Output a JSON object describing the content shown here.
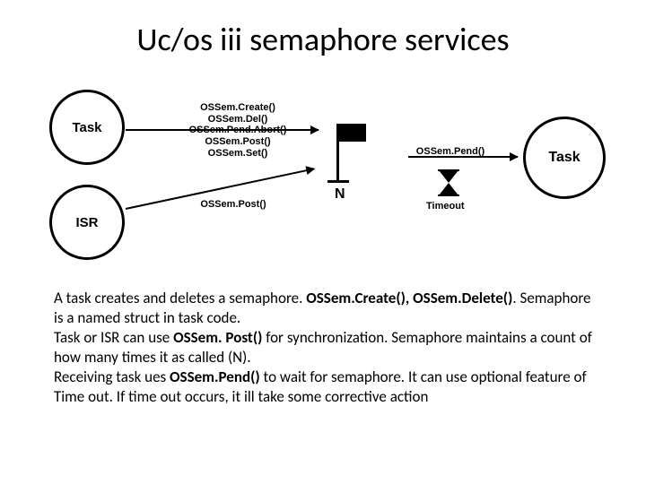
{
  "title": "Uc/os iii semaphore services",
  "nodes": {
    "task_left": "Task",
    "isr": "ISR",
    "task_right": "Task"
  },
  "functions": {
    "create": "OSSem.Create()",
    "del": "OSSem.Del()",
    "pend_abort": "OSSem.Pend.Abort()",
    "post": "OSSem.Post()",
    "set": "OSSem.Set()",
    "isr_post": "OSSem.Post()",
    "pend": "OSSem.Pend()"
  },
  "labels": {
    "n": "N",
    "timeout": "Timeout"
  },
  "body": {
    "p1a": "A task creates and deletes a semaphore. ",
    "p1b": "OSSem.Create(), OSSem.Delete()",
    "p1c": ". Semaphore is a named struct in task code.",
    "p2a": "Task or ISR can use ",
    "p2b": "OSSem. Post()",
    "p2c": " for synchronization. Semaphore maintains a count of how many times it as called (N).",
    "p3a": "Receiving task ues ",
    "p3b": "OSSem.Pend()",
    "p3c": " to wait for semaphore. It can use optional feature of Time out. If time out occurs,  it ill take some corrective action"
  }
}
